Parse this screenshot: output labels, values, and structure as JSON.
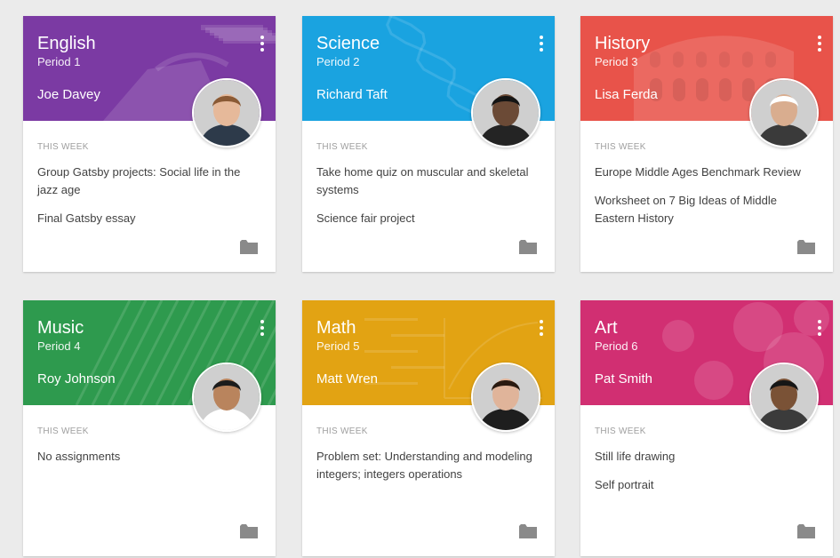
{
  "this_week_label": "THIS WEEK",
  "courses": [
    {
      "title": "English",
      "period": "Period 1",
      "teacher": "Joe Davey",
      "color": "#7b3aa3",
      "tasks": [
        "Group Gatsby projects: Social life in the jazz age",
        "Final Gatsby essay"
      ]
    },
    {
      "title": "Science",
      "period": "Period 2",
      "teacher": "Richard Taft",
      "color": "#1aa3e0",
      "tasks": [
        "Take home quiz on muscular and skeletal systems",
        "Science fair project"
      ]
    },
    {
      "title": "History",
      "period": "Period 3",
      "teacher": "Lisa Ferda",
      "color": "#e8534a",
      "tasks": [
        "Europe Middle Ages Benchmark Review",
        "Worksheet on 7 Big Ideas of Middle Eastern History"
      ]
    },
    {
      "title": "Music",
      "period": "Period 4",
      "teacher": "Roy Johnson",
      "color": "#2e9a4e",
      "tasks": [
        "No assignments"
      ]
    },
    {
      "title": "Math",
      "period": "Period 5",
      "teacher": "Matt Wren",
      "color": "#e2a313",
      "tasks": [
        "Problem set: Understanding and modeling integers; integers operations"
      ]
    },
    {
      "title": "Art",
      "period": "Period 6",
      "teacher": "Pat Smith",
      "color": "#d12f72",
      "tasks": [
        "Still life drawing",
        "Self portrait"
      ]
    }
  ],
  "icons": {
    "menu": "more-vert-icon",
    "folder": "folder-icon"
  }
}
